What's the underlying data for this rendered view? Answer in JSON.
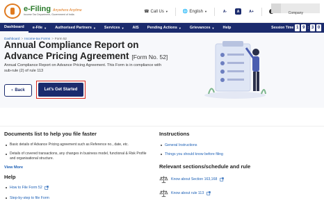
{
  "header": {
    "logo_title": "e-Filing",
    "logo_tagline": "Anywhere Anytime",
    "logo_subtitle": "Income Tax Department, Government of India",
    "call_us": "Call Us",
    "language": "English",
    "font_small": "A-",
    "font_normal": "A",
    "font_large": "A+",
    "user_label": "Company"
  },
  "nav": {
    "items": [
      "Dashboard",
      "e-File",
      "Authorised Partners",
      "Services",
      "AIS",
      "Pending Actions",
      "Grievances",
      "Help"
    ],
    "session_label": "Session Time",
    "session_digits": [
      "1",
      "9",
      "3",
      "0"
    ]
  },
  "breadcrumb": [
    "Dashboard",
    "Income-tax Forms",
    "Form 52"
  ],
  "hero": {
    "title": "Annual Compliance Report on Advance Pricing Agreement",
    "form_no": "[Form No. 52]",
    "description": "Annual Compliance Report on Advance Pricing Agreement. This Form is in compliance with sub-rule (2) of rule 113",
    "back_label": "Back",
    "start_label": "Let's Get Started"
  },
  "documents": {
    "title": "Documents list to help you file faster",
    "items": [
      "Basic details of Advance Pricing agreement such as Reference no., date, etc.",
      "Details of covered transactions, any changes in business model, functional & Risk Profile and organisational structure."
    ],
    "view_more": "View More"
  },
  "help": {
    "title": "Help",
    "items": [
      "How to File Form 52",
      "Step-by-step to file Form"
    ]
  },
  "instructions": {
    "title": "Instructions",
    "items": [
      "General Instructions",
      "Things you should know before filing"
    ]
  },
  "related": {
    "title": "Relevant sections/schedule and rule",
    "items": [
      "Know about Section 163,168",
      "Know about rule 113"
    ]
  },
  "colors": {
    "nav_bg": "#1b2b6d",
    "link": "#1b5fb5",
    "highlight": "#d9261c"
  }
}
